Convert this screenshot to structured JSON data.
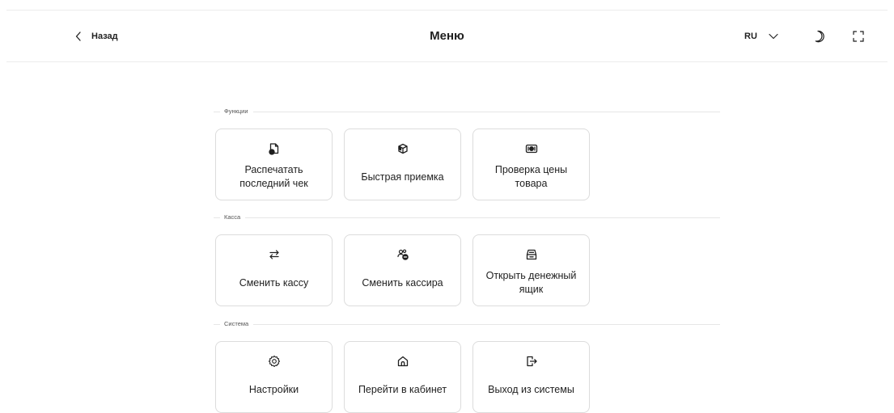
{
  "header": {
    "back_label": "Назад",
    "title": "Меню",
    "language": "RU"
  },
  "sections": [
    {
      "label": "Функции",
      "cards": [
        {
          "label": "Распечатать последний чек",
          "icon": "receipt-print-icon"
        },
        {
          "label": "Быстрая приемка",
          "icon": "box-receive-icon"
        },
        {
          "label": "Проверка цены товара",
          "icon": "price-check-icon"
        }
      ]
    },
    {
      "label": "Касса",
      "cards": [
        {
          "label": "Сменить кассу",
          "icon": "swap-arrows-icon"
        },
        {
          "label": "Сменить кассира",
          "icon": "switch-user-icon"
        },
        {
          "label": "Открыть денежный ящик",
          "icon": "cash-drawer-icon"
        }
      ]
    },
    {
      "label": "Система",
      "cards": [
        {
          "label": "Настройки",
          "icon": "gear-icon"
        },
        {
          "label": "Перейти в кабинет",
          "icon": "home-icon"
        },
        {
          "label": "Выход из системы",
          "icon": "logout-icon"
        }
      ]
    }
  ]
}
